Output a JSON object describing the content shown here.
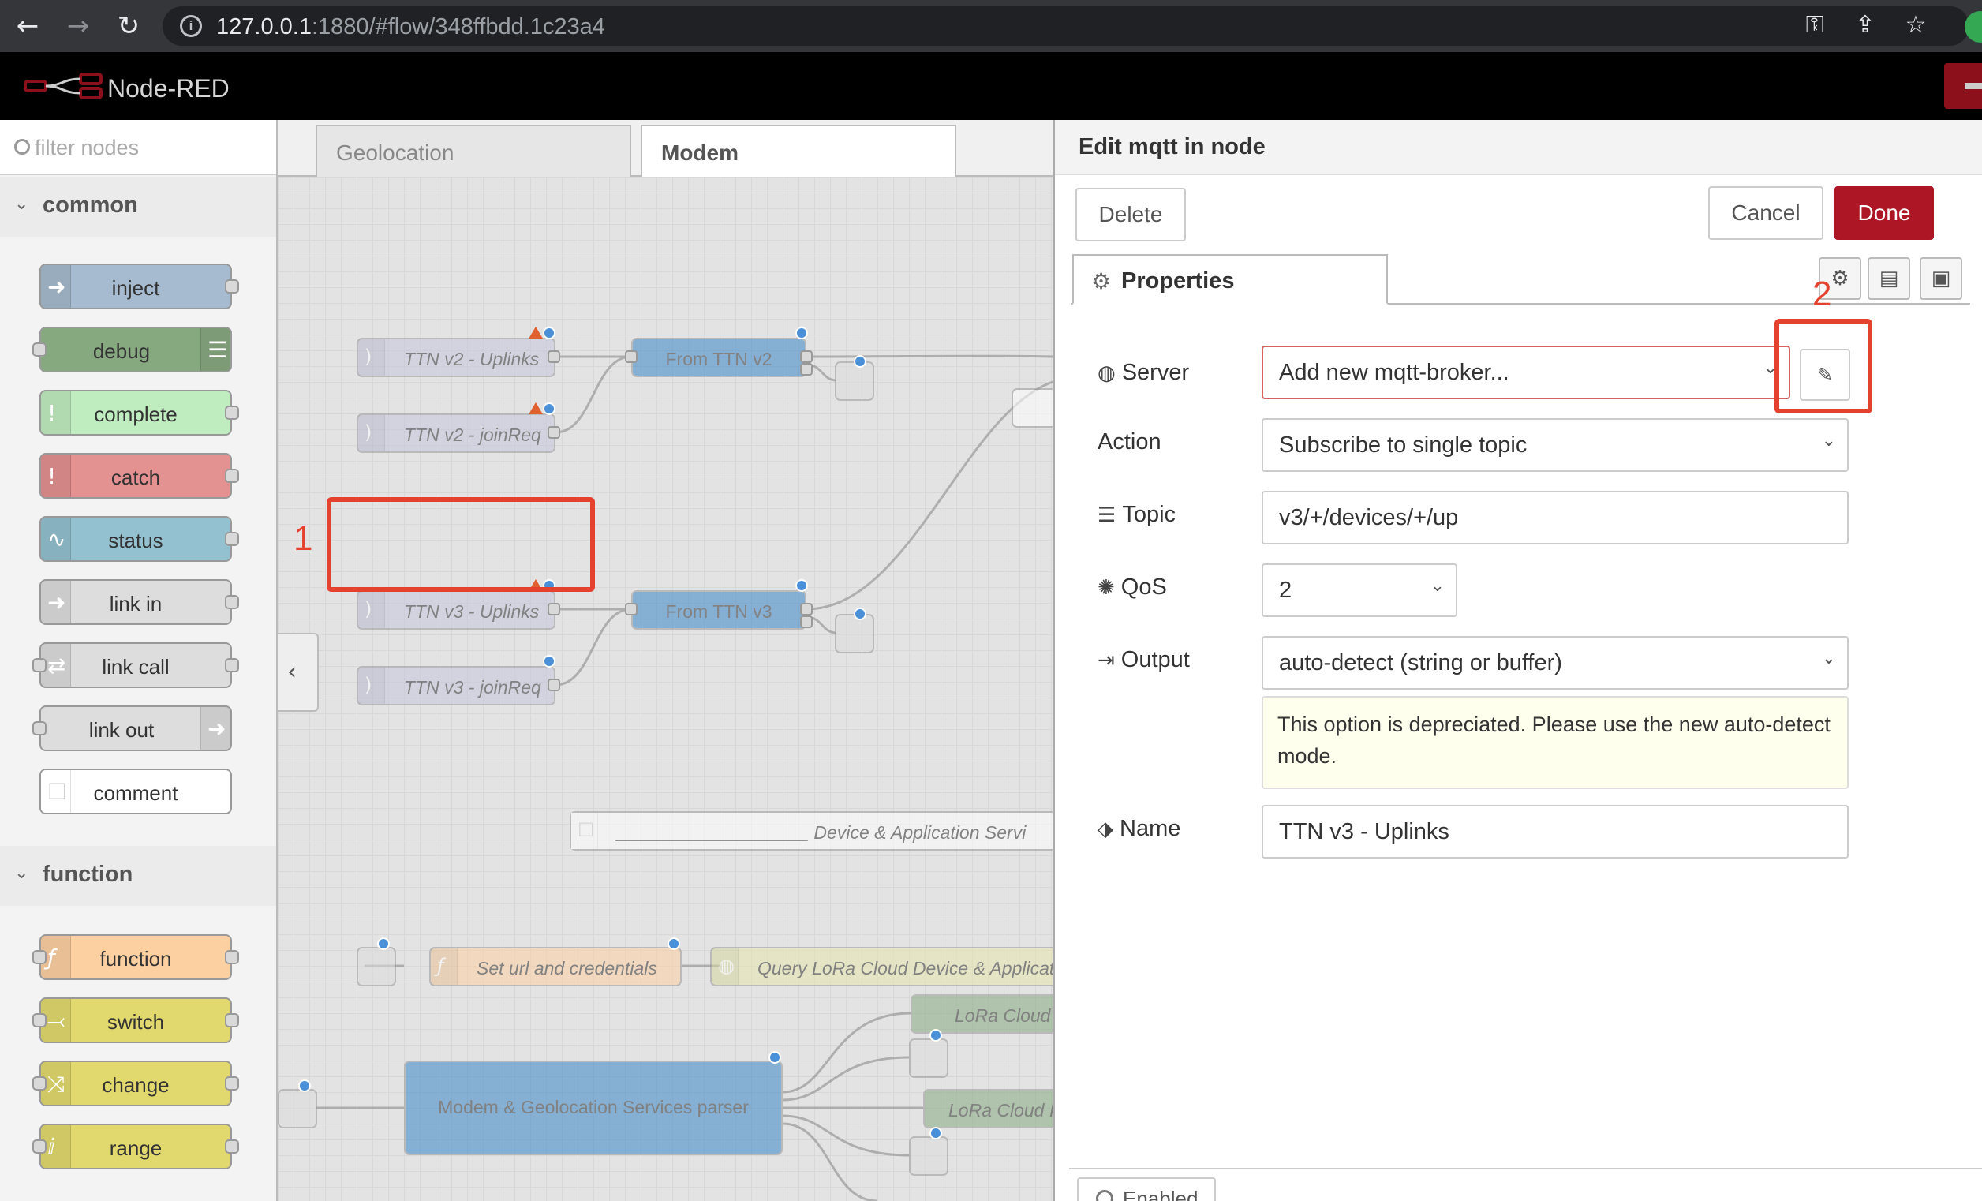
{
  "browser": {
    "url_host": "127.0.0.1",
    "url_rest": ":1880/#flow/348ffbdd.1c23a4",
    "icons": [
      "back-icon",
      "forward-icon",
      "reload-icon",
      "info-icon",
      "key-icon",
      "share-icon",
      "star-icon"
    ]
  },
  "app": {
    "brand": "Node-RED"
  },
  "palette": {
    "filter_placeholder": "filter nodes",
    "categories": [
      {
        "label": "common",
        "nodes": [
          "inject",
          "debug",
          "complete",
          "catch",
          "status",
          "link in",
          "link call",
          "link out",
          "comment"
        ]
      },
      {
        "label": "function",
        "nodes": [
          "function",
          "switch",
          "change",
          "range"
        ]
      }
    ],
    "colors": {
      "inject": "#a6bbcf",
      "debug": "#87a980",
      "complete": "#c0edc0",
      "catch": "#e49191",
      "status": "#94c1d0",
      "link": "#dddddd",
      "comment": "#ffffff",
      "function": "#fdd0a2",
      "switch": "#e2d96e",
      "range": "#e2d96e"
    }
  },
  "workspace": {
    "tabs": [
      "Geolocation",
      "Modem"
    ],
    "active_tab": "Modem",
    "nodes": {
      "ttn_v2_uplinks": "TTN v2 - Uplinks",
      "ttn_v2_joinreq": "TTN v2 - joinReq",
      "from_ttn_v2": "From TTN v2",
      "ttn_v3_uplinks": "TTN v3 - Uplinks",
      "ttn_v3_joinreq": "TTN v3 - joinReq",
      "from_ttn_v3": "From TTN v3",
      "comment_device": "___________________ Device & Application Servi",
      "set_url": "Set url and credentials",
      "query_lora": "Query LoRa Cloud Device & Applicati",
      "lora_cloud_1": "LoRa Cloud",
      "lora_cloud_2": "LoRa Cloud I",
      "parser": "Modem & Geolocation Services parser"
    }
  },
  "annotations": {
    "callout1": "1",
    "callout2": "2",
    "color": "#e4412f"
  },
  "tray": {
    "title": "Edit mqtt in node",
    "delete_label": "Delete",
    "cancel_label": "Cancel",
    "done_label": "Done",
    "properties_tab": "Properties",
    "fields": {
      "server_label": "Server",
      "server_value": "Add new mqtt-broker...",
      "action_label": "Action",
      "action_value": "Subscribe to single topic",
      "topic_label": "Topic",
      "topic_value": "v3/+/devices/+/up",
      "qos_label": "QoS",
      "qos_value": "2",
      "output_label": "Output",
      "output_value": "auto-detect (string or buffer)",
      "output_note": "This option is depreciated. Please use the new auto-detect mode.",
      "name_label": "Name",
      "name_value": "TTN v3 - Uplinks"
    },
    "enabled_label": "Enabled",
    "colors": {
      "done": "#ad1625",
      "error_border": "#d6615f",
      "note_bg": "#ffffee"
    }
  }
}
